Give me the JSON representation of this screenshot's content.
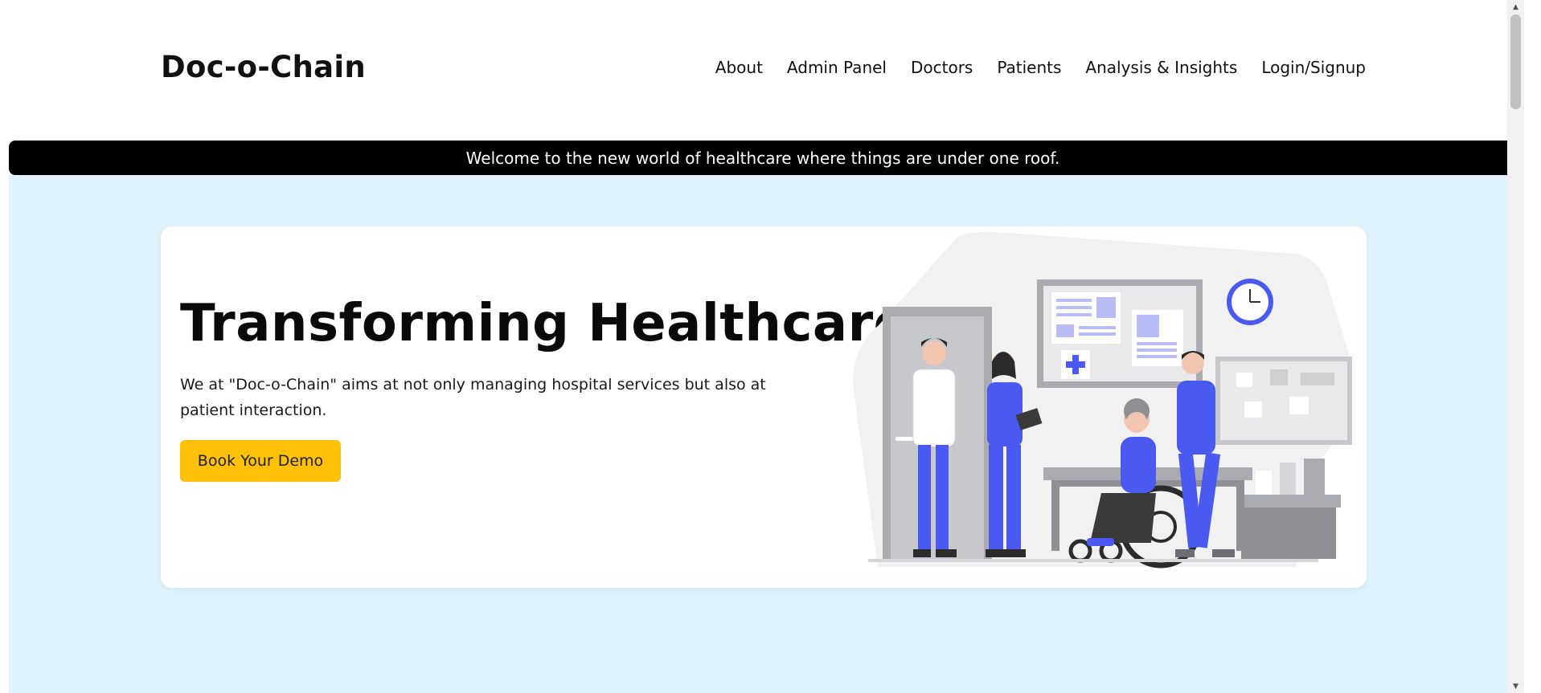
{
  "header": {
    "brand": "Doc-o-Chain",
    "nav": [
      {
        "label": "About"
      },
      {
        "label": "Admin Panel"
      },
      {
        "label": "Doctors"
      },
      {
        "label": "Patients"
      },
      {
        "label": "Analysis & Insights"
      },
      {
        "label": "Login/Signup"
      }
    ]
  },
  "announcement": "Welcome to the new world of healthcare where things are under one roof.",
  "hero": {
    "title": "Transforming Healthcare",
    "description": "We at \"Doc-o-Chain\" aims at not only managing hospital services but also at patient interaction.",
    "cta_label": "Book Your Demo",
    "illustration": "healthcare-staff-illustration"
  },
  "colors": {
    "accent": "#ffc107",
    "hero_background": "#e0f3fc",
    "announcement_background": "#000000",
    "illustration_blue": "#4a5af0"
  }
}
